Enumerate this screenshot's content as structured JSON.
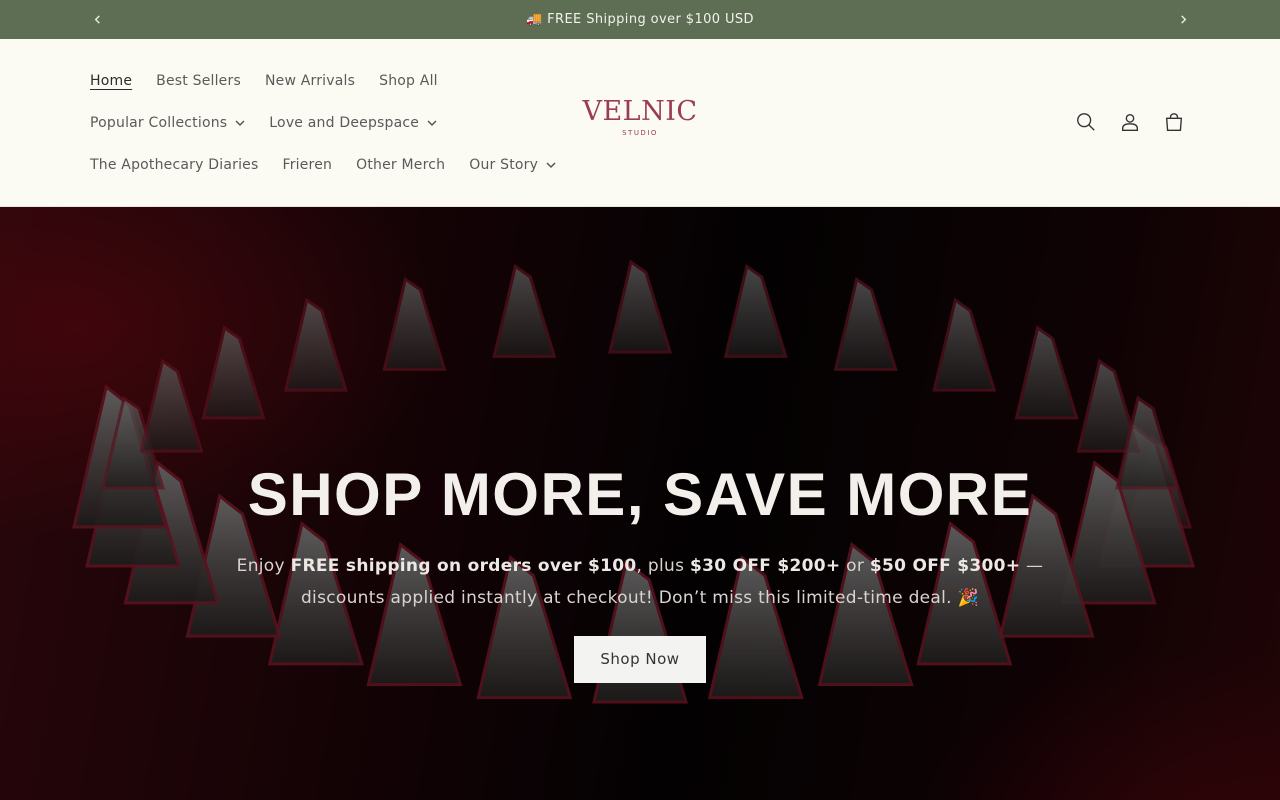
{
  "announcement": {
    "text": "🚚 FREE Shipping over $100 USD",
    "prev_icon": "chevron-left-icon",
    "next_icon": "chevron-right-icon"
  },
  "header": {
    "nav": {
      "row1": [
        {
          "label": "Home",
          "active": true
        },
        {
          "label": "Best Sellers"
        },
        {
          "label": "New Arrivals"
        },
        {
          "label": "Shop All"
        }
      ],
      "row2": [
        {
          "label": "Popular Collections",
          "dropdown": true
        },
        {
          "label": "Love and Deepspace",
          "dropdown": true
        }
      ],
      "row3": [
        {
          "label": "The Apothecary Diaries"
        },
        {
          "label": "Frieren"
        },
        {
          "label": "Other Merch"
        },
        {
          "label": "Our Story",
          "dropdown": true
        }
      ]
    },
    "logo": {
      "brand": "VELNIC",
      "sub": "STUDIO",
      "color": "#9b3b55"
    },
    "icons": [
      "search-icon",
      "account-icon",
      "cart-icon"
    ]
  },
  "hero": {
    "title": "SHOP MORE, SAVE MORE",
    "text": {
      "p1": "Enjoy ",
      "b1": "FREE shipping on orders over $100",
      "p2": ", plus ",
      "b2": "$30 OFF $200+",
      "p3": " or ",
      "b3": "$50 OFF $300+",
      "p4": " — discounts applied instantly at checkout! Don’t miss this limited-time deal. 🎉"
    },
    "button": "Shop Now"
  },
  "colors": {
    "announcement_bg": "#5d6e54",
    "header_bg": "#fbfaf3",
    "brand": "#9b3b55"
  }
}
